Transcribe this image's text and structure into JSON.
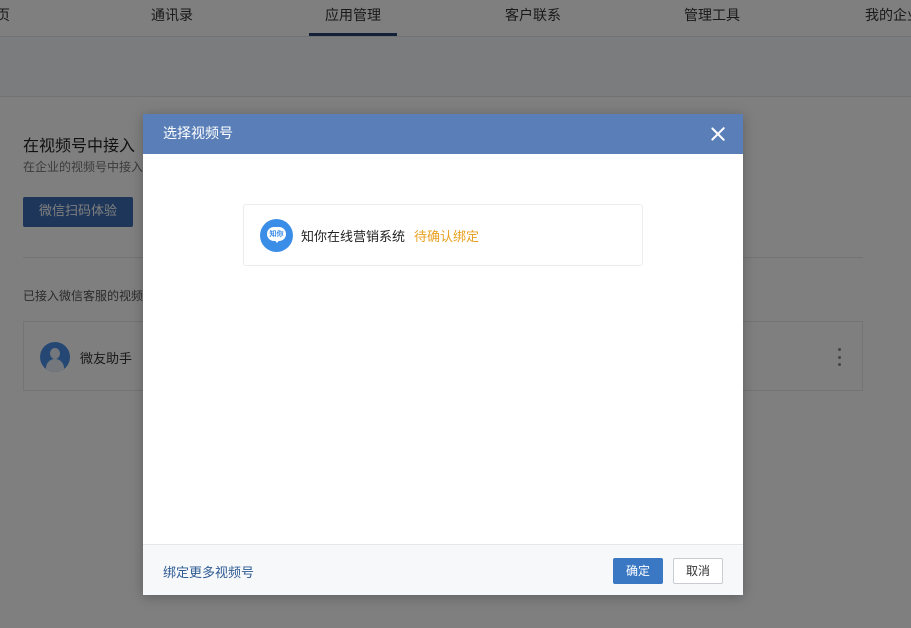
{
  "nav": {
    "items": [
      {
        "label": "页"
      },
      {
        "label": "通讯录"
      },
      {
        "label": "应用管理"
      },
      {
        "label": "客户联系"
      },
      {
        "label": "管理工具"
      },
      {
        "label": "我的企业"
      }
    ],
    "active_index": 2
  },
  "page": {
    "section_title": "在视频号中接入",
    "section_desc": "在企业的视频号中接入",
    "try_button": "微信扫码体验",
    "connected_label": "已接入微信客服的视频号",
    "account": {
      "name": "微友助手",
      "more_icon": "more-vertical-icon"
    }
  },
  "modal": {
    "title": "选择视频号",
    "close_icon": "close-icon",
    "channel": {
      "logo_text": "知你",
      "name": "知你在线营销系统",
      "status": "待确认绑定"
    },
    "footer": {
      "bind_more": "绑定更多视频号",
      "confirm": "确定",
      "cancel": "取消"
    }
  },
  "colors": {
    "header_blue": "#5a7fb8",
    "primary_button": "#3a78c4",
    "status_orange": "#e8a020",
    "link_blue": "#2e5b94",
    "nav_active": "#24436e"
  }
}
